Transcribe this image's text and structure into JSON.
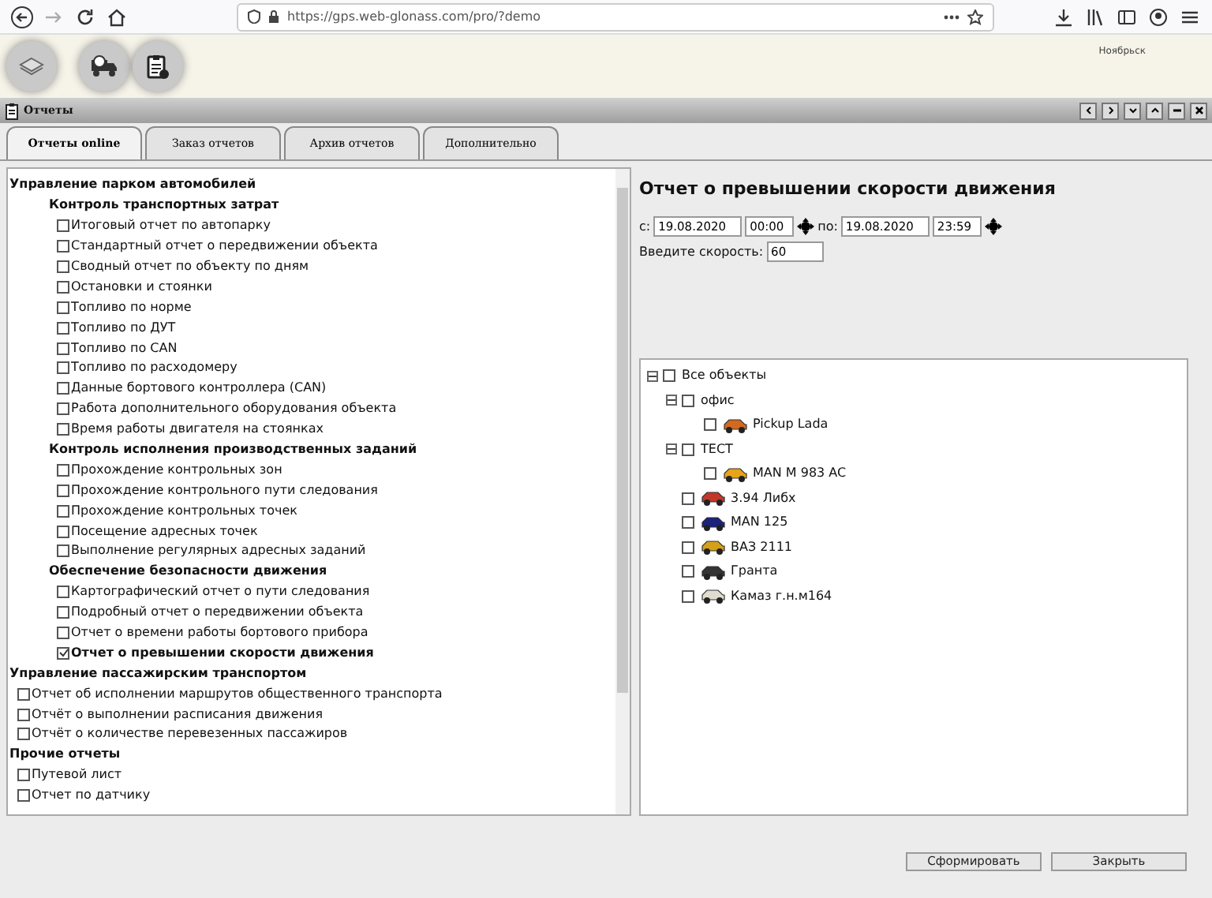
{
  "browser": {
    "url": "https://gps.web-glonass.com/pro/?demo"
  },
  "map": {
    "labels": [
      "Ноябрьск"
    ]
  },
  "window": {
    "title": "Отчеты"
  },
  "tabs": [
    {
      "label": "Отчеты online",
      "selected": true
    },
    {
      "label": "Заказ отчетов",
      "selected": false
    },
    {
      "label": "Архив отчетов",
      "selected": false
    },
    {
      "label": "Дополнительно",
      "selected": false
    }
  ],
  "report_list": [
    {
      "kind": "group",
      "label": "Управление парком автомобилей",
      "children": [
        {
          "kind": "group",
          "label": "Контроль транспортных затрат",
          "children": [
            {
              "kind": "report",
              "label": "Итоговый отчет по автопарку",
              "checked": false
            },
            {
              "kind": "report",
              "label": "Стандартный отчет о передвижении объекта",
              "checked": false
            },
            {
              "kind": "report",
              "label": "Сводный отчет по объекту по дням",
              "checked": false
            },
            {
              "kind": "report",
              "label": "Остановки и стоянки",
              "checked": false
            },
            {
              "kind": "report",
              "label": "Топливо по норме",
              "checked": false
            },
            {
              "kind": "report",
              "label": "Топливо по ДУТ",
              "checked": false
            },
            {
              "kind": "report",
              "label": "Топливо по CAN",
              "checked": false
            },
            {
              "kind": "report",
              "label": "Топливо по расходомеру",
              "checked": false
            },
            {
              "kind": "report",
              "label": "Данные бортового контроллера (CAN)",
              "checked": false
            },
            {
              "kind": "report",
              "label": "Работа дополнительного оборудования объекта",
              "checked": false
            },
            {
              "kind": "report",
              "label": "Время работы двигателя на стоянках",
              "checked": false
            }
          ]
        },
        {
          "kind": "group",
          "label": "Контроль исполнения производственных заданий",
          "children": [
            {
              "kind": "report",
              "label": "Прохождение контрольных зон",
              "checked": false
            },
            {
              "kind": "report",
              "label": "Прохождение контрольного пути следования",
              "checked": false
            },
            {
              "kind": "report",
              "label": "Прохождение контрольных точек",
              "checked": false
            },
            {
              "kind": "report",
              "label": "Посещение адресных точек",
              "checked": false
            },
            {
              "kind": "report",
              "label": "Выполнение регулярных адресных заданий",
              "checked": false
            }
          ]
        },
        {
          "kind": "group",
          "label": "Обеспечение безопасности движения",
          "children": [
            {
              "kind": "report",
              "label": "Картографический отчет о пути следования",
              "checked": false
            },
            {
              "kind": "report",
              "label": "Подробный отчет о передвижении объекта",
              "checked": false
            },
            {
              "kind": "report",
              "label": "Отчет о времени работы бортового прибора",
              "checked": false
            },
            {
              "kind": "report",
              "label": "Отчет о превышении скорости движения",
              "checked": true
            }
          ]
        }
      ]
    },
    {
      "kind": "group",
      "label": "Управление пассажирским транспортом",
      "children": [
        {
          "kind": "report",
          "label": "Отчет об исполнении маршрутов общественного транспорта",
          "checked": false
        },
        {
          "kind": "report",
          "label": "Отчёт о выполнении расписания движения",
          "checked": false
        },
        {
          "kind": "report",
          "label": "Отчёт о количестве перевезенных пассажиров",
          "checked": false
        }
      ]
    },
    {
      "kind": "group",
      "label": "Прочие отчеты",
      "children": [
        {
          "kind": "report",
          "label": "Путевой лист",
          "checked": false
        },
        {
          "kind": "report",
          "label": "Отчет по датчику",
          "checked": false
        }
      ]
    }
  ],
  "report_form": {
    "title": "Отчет о превышении скорости движения",
    "from_label": "с:",
    "from_date": "19.08.2020",
    "from_time": "00:00",
    "to_label": "по:",
    "to_date": "19.08.2020",
    "to_time": "23:59",
    "speed_label": "Введите скорость:",
    "speed_value": "60"
  },
  "objects": [
    {
      "kind": "group",
      "label": "Все объекты",
      "checked": false,
      "expanded": true,
      "children": [
        {
          "kind": "group",
          "label": "офис",
          "checked": false,
          "expanded": true,
          "children": [
            {
              "kind": "vehicle",
              "label": "Pickup Lada",
              "checked": false
            }
          ]
        },
        {
          "kind": "group",
          "label": "ТЕСТ",
          "checked": false,
          "expanded": true,
          "children": [
            {
              "kind": "vehicle",
              "label": "MAN M 983 AC",
              "checked": false
            }
          ]
        },
        {
          "kind": "vehicle",
          "label": "3.94 Либх",
          "checked": false
        },
        {
          "kind": "vehicle",
          "label": "MAN 125",
          "checked": false
        },
        {
          "kind": "vehicle",
          "label": "ВАЗ 2111",
          "checked": false
        },
        {
          "kind": "vehicle",
          "label": "Гранта",
          "checked": false
        },
        {
          "kind": "vehicle",
          "label": "Камаз г.н.м164",
          "checked": false
        }
      ]
    }
  ],
  "buttons": [
    "Сформировать",
    "Закрыть"
  ]
}
